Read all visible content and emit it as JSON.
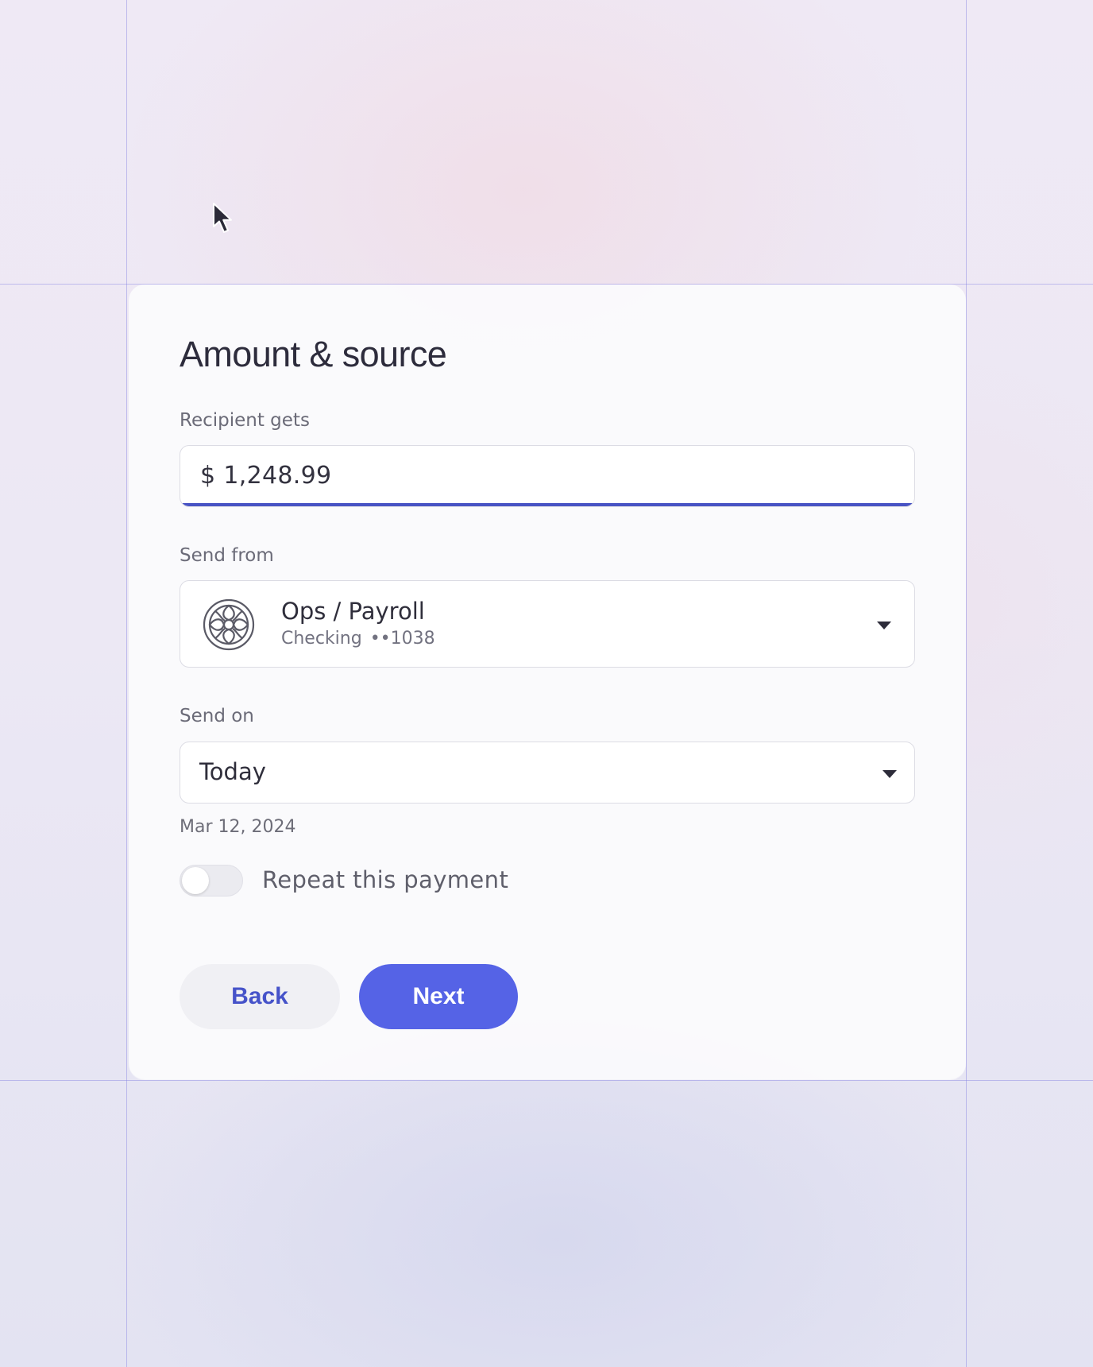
{
  "form": {
    "title": "Amount & source",
    "amount": {
      "label": "Recipient gets",
      "currency_symbol": "$",
      "value": "1,248.99"
    },
    "source": {
      "label": "Send from",
      "account_name": "Ops / Payroll",
      "account_type": "Checking",
      "account_mask": "••1038",
      "logo_icon": "ornate-emblem-icon"
    },
    "schedule": {
      "label": "Send on",
      "selected": "Today",
      "date_hint": "Mar 12, 2024"
    },
    "repeat": {
      "label": "Repeat this payment",
      "enabled": false
    },
    "actions": {
      "back_label": "Back",
      "next_label": "Next"
    }
  },
  "colors": {
    "accent": "#5563e6",
    "focus_underline": "#4853c4",
    "back_text": "#4653c9"
  }
}
